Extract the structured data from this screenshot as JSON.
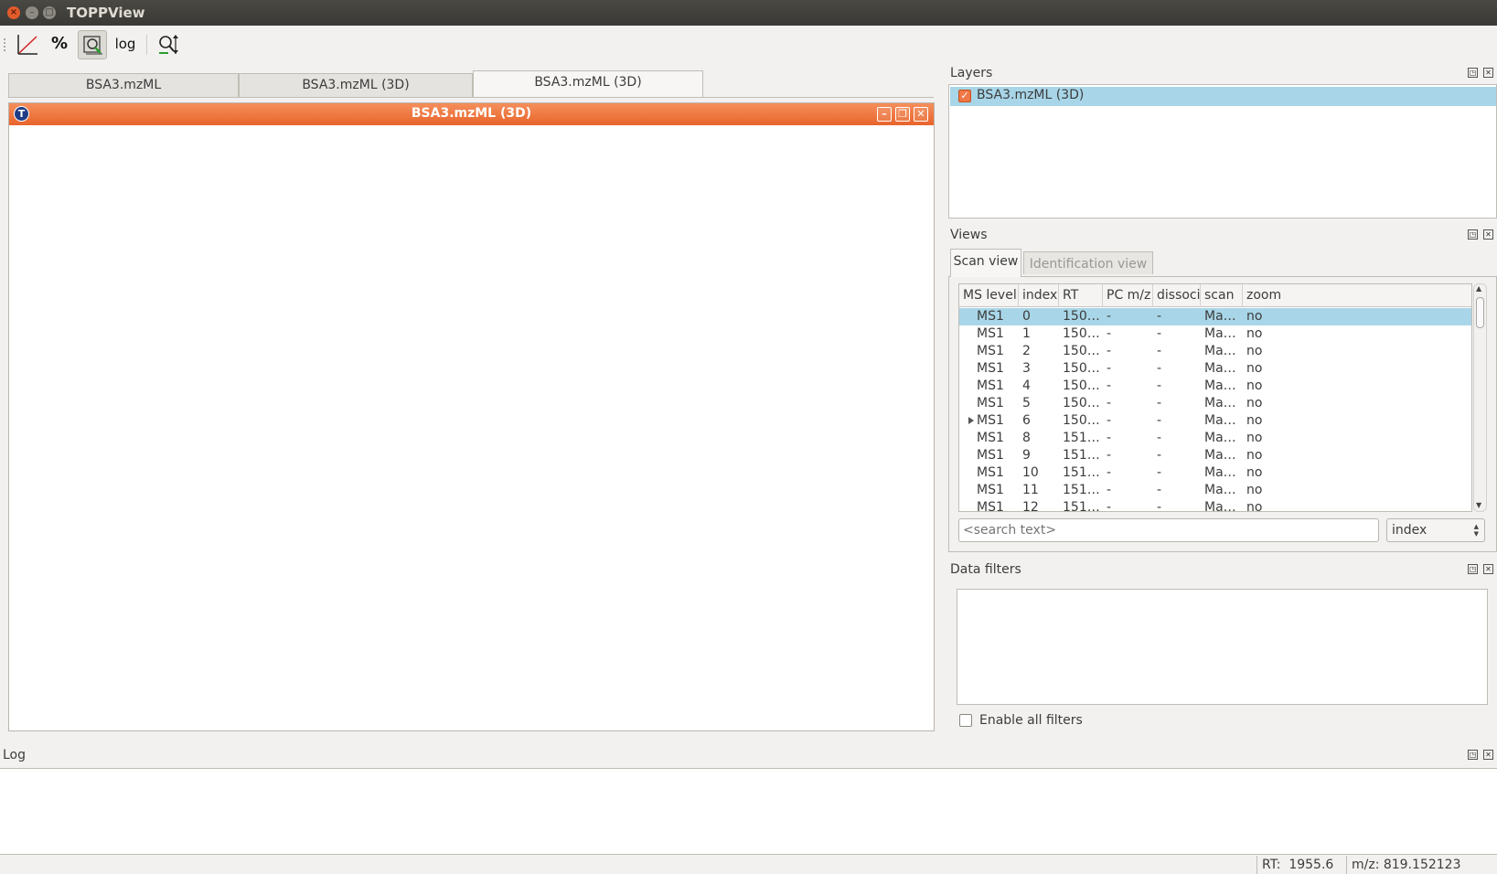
{
  "window": {
    "title": "TOPPView"
  },
  "toolbar": {
    "buttons": [
      {
        "name": "linear-intensity-icon"
      },
      {
        "name": "percentage-intensity-icon",
        "label": "%"
      },
      {
        "name": "snap-intensity-icon"
      },
      {
        "name": "log-intensity-icon",
        "label": "log"
      },
      {
        "name": "reset-zoom-icon"
      }
    ]
  },
  "doc_tabs": [
    "BSA3.mzML",
    "BSA3.mzML (3D)",
    "BSA3.mzML (3D)"
  ],
  "active_doc_tab": 2,
  "subwindow": {
    "title": "BSA3.mzML (3D)",
    "icon_glyph": "T"
  },
  "layers": {
    "title": "Layers",
    "items": [
      {
        "label": "BSA3.mzML (3D)",
        "checked": true
      }
    ]
  },
  "views": {
    "title": "Views",
    "tabs": [
      "Scan view",
      "Identification view"
    ],
    "columns": [
      "MS level",
      "index",
      "RT",
      "PC m/z",
      "dissoci",
      "scan",
      "zoom"
    ],
    "rows": [
      [
        "MS1",
        "0",
        "150…",
        "-",
        "-",
        "Ma…",
        "no"
      ],
      [
        "MS1",
        "1",
        "150…",
        "-",
        "-",
        "Ma…",
        "no"
      ],
      [
        "MS1",
        "2",
        "150…",
        "-",
        "-",
        "Ma…",
        "no"
      ],
      [
        "MS1",
        "3",
        "150…",
        "-",
        "-",
        "Ma…",
        "no"
      ],
      [
        "MS1",
        "4",
        "150…",
        "-",
        "-",
        "Ma…",
        "no"
      ],
      [
        "MS1",
        "5",
        "150…",
        "-",
        "-",
        "Ma…",
        "no"
      ],
      [
        "MS1",
        "6",
        "150…",
        "-",
        "-",
        "Ma…",
        "no"
      ],
      [
        "MS1",
        "8",
        "151…",
        "-",
        "-",
        "Ma…",
        "no"
      ],
      [
        "MS1",
        "9",
        "151…",
        "-",
        "-",
        "Ma…",
        "no"
      ],
      [
        "MS1",
        "10",
        "151…",
        "-",
        "-",
        "Ma…",
        "no"
      ],
      [
        "MS1",
        "11",
        "151…",
        "-",
        "-",
        "Ma…",
        "no"
      ],
      [
        "MS1",
        "12",
        "151…",
        "-",
        "-",
        "Ma…",
        "no"
      ]
    ],
    "selected_row": 0,
    "expandable_row": 6,
    "search_placeholder": "<search text>",
    "search_field": "index"
  },
  "filters": {
    "title": "Data filters",
    "enable_all_label": "Enable all filters",
    "enable_all_checked": false
  },
  "log": {
    "title": "Log"
  },
  "status": {
    "rt": "RT:  1955.6",
    "mz": "m/z: 819.152123"
  },
  "colors": {
    "accent": "#f07746",
    "selection": "#a8d6e8",
    "titlebar": "#3c3b37"
  }
}
